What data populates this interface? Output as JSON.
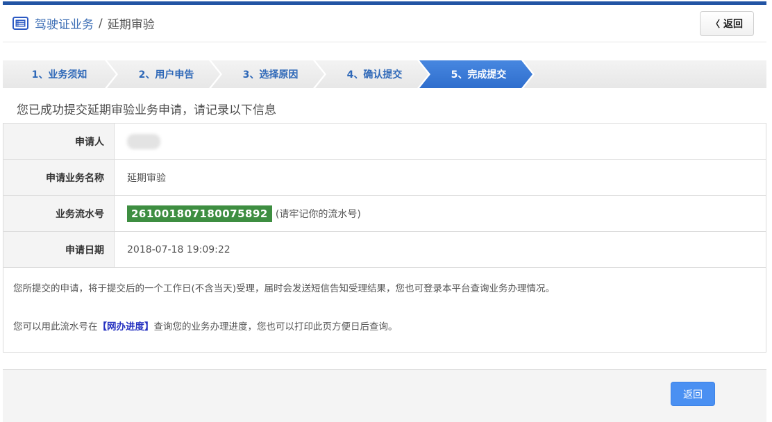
{
  "header": {
    "title_primary": "驾驶证业务",
    "title_separator": "/",
    "title_secondary": "延期审验",
    "back_chevron": "〈",
    "back_label": "返回"
  },
  "steps": [
    {
      "label": "1、业务须知",
      "active": false
    },
    {
      "label": "2、用户申告",
      "active": false
    },
    {
      "label": "3、选择原因",
      "active": false
    },
    {
      "label": "4、确认提交",
      "active": false
    },
    {
      "label": "5、完成提交",
      "active": true
    }
  ],
  "main": {
    "success_message": "您已成功提交延期审验业务申请，请记录以下信息",
    "table": {
      "rows": [
        {
          "label": "申请人",
          "value": "",
          "redacted": true
        },
        {
          "label": "申请业务名称",
          "value": "延期审验"
        },
        {
          "label": "业务流水号",
          "serial": "261001807180075892",
          "note": "(请牢记你的流水号)"
        },
        {
          "label": "申请日期",
          "value": "2018-07-18 19:09:22"
        }
      ]
    },
    "notes": [
      {
        "text": "您所提交的申请，将于提交后的一个工作日(不含当天)受理，届时会发送短信告知受理结果，您也可登录本平台查询业务办理情况。"
      },
      {
        "text_before": "您可以用此流水号在",
        "link": "【网办进度】",
        "text_after": "查询您的业务办理进度，您也可以打印此页方便日后查询。"
      }
    ]
  },
  "footer": {
    "back_label": "返回"
  },
  "icons": {
    "header_icon": "list-icon",
    "back_icon": "chevron-left-icon"
  },
  "colors": {
    "top_bar": "#2254a4",
    "step_active": "#3b7dd9",
    "step_text": "#2e68b8",
    "serial_badge": "#3e8e41",
    "primary_button": "#4a90f2",
    "link": "#2531c0"
  }
}
